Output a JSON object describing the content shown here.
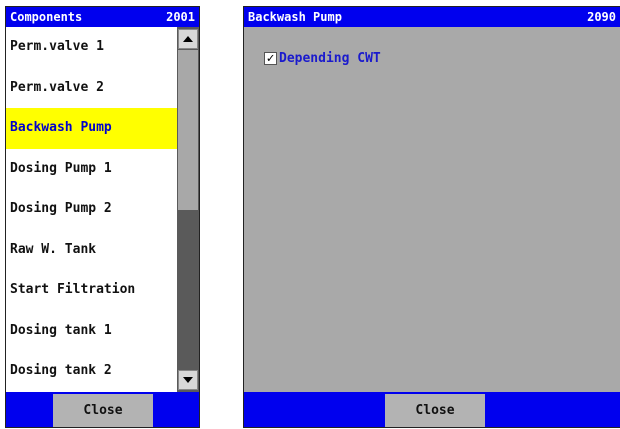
{
  "left_panel": {
    "title": "Components",
    "code": "2001",
    "items": [
      {
        "label": "Perm.valve 1"
      },
      {
        "label": "Perm.valve 2"
      },
      {
        "label": "Backwash Pump",
        "selected": true
      },
      {
        "label": "Dosing Pump 1"
      },
      {
        "label": "Dosing Pump 2"
      },
      {
        "label": "Raw W. Tank"
      },
      {
        "label": "Start Filtration"
      },
      {
        "label": "Dosing tank 1"
      },
      {
        "label": "Dosing tank 2"
      }
    ],
    "close_label": "Close"
  },
  "right_panel": {
    "title": "Backwash Pump",
    "code": "2090",
    "checkbox": {
      "label": "Depending CWT",
      "checked": true,
      "mark": "✓"
    },
    "close_label": "Close"
  },
  "colors": {
    "titlebar": "#0000ee",
    "selected_bg": "#ffff00",
    "selected_text": "#0000cc",
    "panel_bg": "#a9a9a9",
    "button_bg": "#b3b3b3"
  },
  "icons": [
    "scroll-up-arrow-icon",
    "scroll-down-arrow-icon",
    "checkmark-icon"
  ]
}
